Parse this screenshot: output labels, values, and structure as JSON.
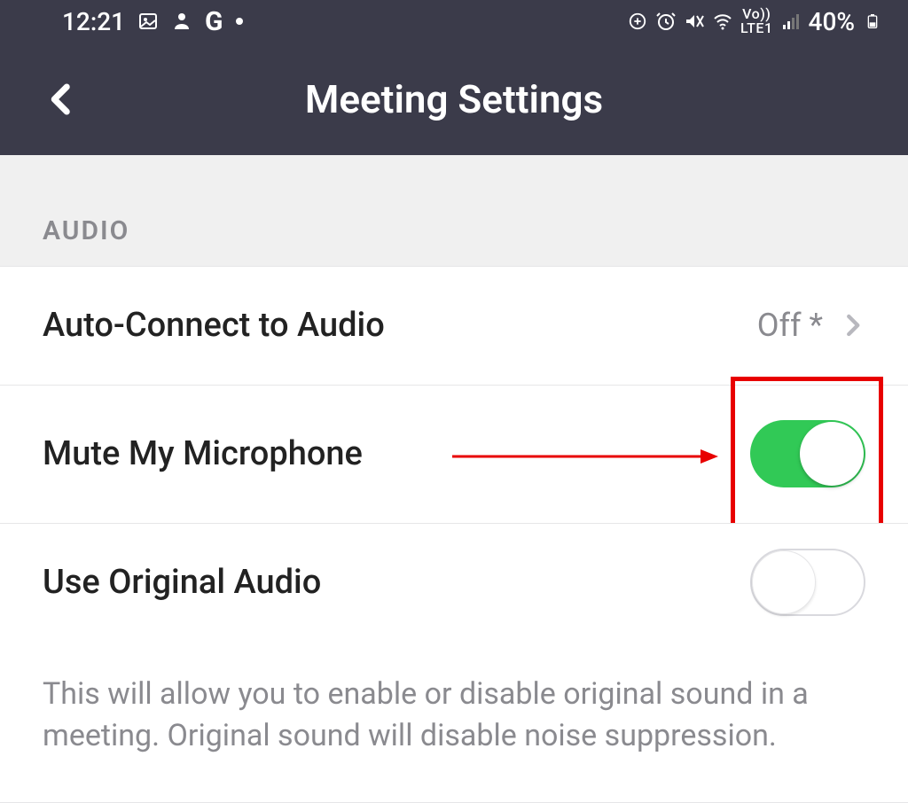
{
  "status": {
    "time": "12:21",
    "battery_text": "40%"
  },
  "header": {
    "title": "Meeting Settings"
  },
  "section": {
    "audio_label": "AUDIO"
  },
  "rows": {
    "auto_connect": {
      "label": "Auto-Connect to Audio",
      "value": "Off *"
    },
    "mute_mic": {
      "label": "Mute My Microphone",
      "state": "on"
    },
    "orig_audio": {
      "label": "Use Original Audio",
      "state": "off"
    }
  },
  "hint": "This will allow you to enable or disable original sound in a meeting. Original sound will disable noise suppression.",
  "colors": {
    "accent_green": "#31c956",
    "annotation_red": "#e80000",
    "header_bg": "#3b3b4a"
  }
}
